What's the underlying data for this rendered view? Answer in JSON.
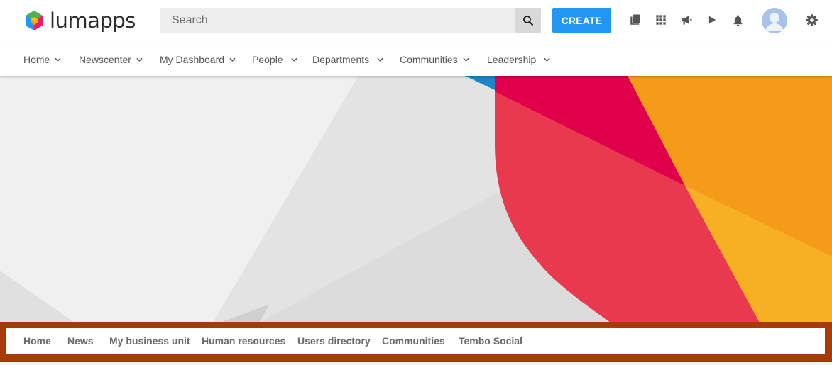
{
  "brand": {
    "name": "lumapps",
    "logo_colors": [
      "#4caf50",
      "#e91e63",
      "#ffc107",
      "#2196f3"
    ]
  },
  "search": {
    "placeholder": "Search",
    "icon": "search-icon"
  },
  "toolbar": {
    "create_label": "CREATE",
    "accent_color": "#2196f3",
    "icons": [
      "directory-icon",
      "apps-grid-icon",
      "megaphone-icon",
      "play-icon",
      "bell-icon",
      "avatar",
      "gear-icon"
    ]
  },
  "main_nav": {
    "items": [
      {
        "label": "Home",
        "has_dropdown": true
      },
      {
        "label": "Newscenter",
        "has_dropdown": true
      },
      {
        "label": "My Dashboard",
        "has_dropdown": true
      },
      {
        "label": "People",
        "has_dropdown": true
      },
      {
        "label": "Departments",
        "has_dropdown": true
      },
      {
        "label": "Communities",
        "has_dropdown": true
      },
      {
        "label": "Leadership",
        "has_dropdown": true
      }
    ]
  },
  "banner": {
    "colors": [
      "#f0f0f0",
      "#e3e3e3",
      "#dcdcdc",
      "#e8394f",
      "#e0004b",
      "#f49c1a",
      "#f7b023",
      "#1b85c7"
    ]
  },
  "sub_nav": {
    "highlight_color": "#a83a08",
    "items": [
      {
        "label": "Home"
      },
      {
        "label": "News"
      },
      {
        "label": "My business unit"
      },
      {
        "label": "Human resources"
      },
      {
        "label": "Users directory"
      },
      {
        "label": "Communities"
      },
      {
        "label": "Tembo Social"
      }
    ]
  }
}
